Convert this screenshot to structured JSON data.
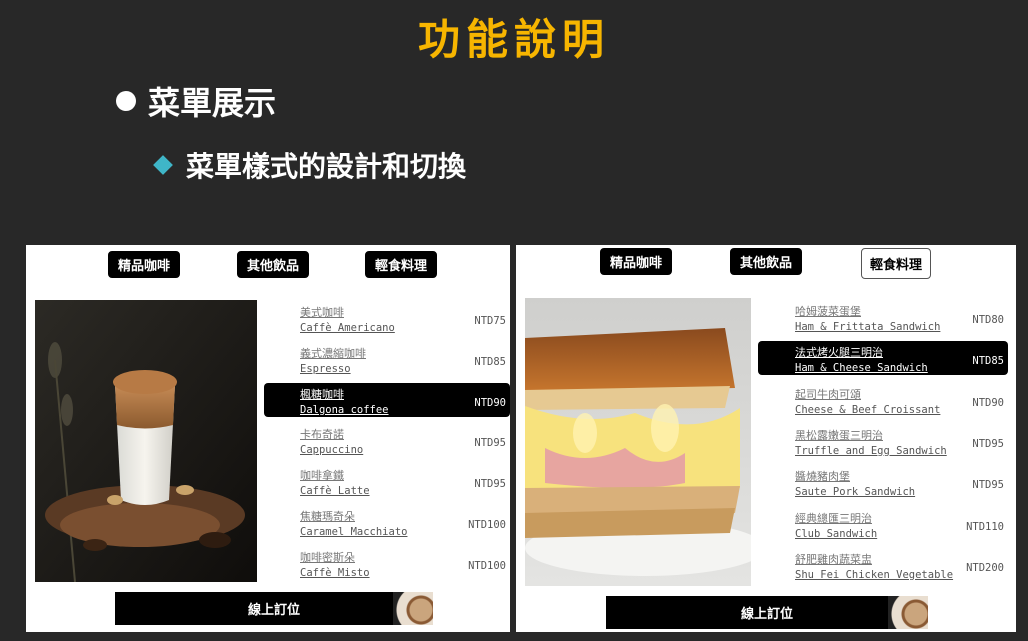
{
  "slide": {
    "title": "功能說明",
    "bullet1": "菜單展示",
    "bullet2": "菜單樣式的設計和切換"
  },
  "menu_left": {
    "tabs": [
      "精品咖啡",
      "其他飲品",
      "輕食料理"
    ],
    "items": [
      {
        "zh": "美式咖啡",
        "en": "Caffè Americano",
        "price": "NTD75"
      },
      {
        "zh": "義式濃縮咖啡",
        "en": "Espresso",
        "price": "NTD85"
      },
      {
        "zh": "楓糖咖啡",
        "en": "Dalgona coffee",
        "price": "NTD90",
        "active": true
      },
      {
        "zh": "卡布奇諾",
        "en": "Cappuccino",
        "price": "NTD95"
      },
      {
        "zh": "咖啡拿鐵",
        "en": "Caffè Latte",
        "price": "NTD95"
      },
      {
        "zh": "焦糖瑪奇朵",
        "en": "Caramel Macchiato",
        "price": "NTD100"
      },
      {
        "zh": "咖啡密斯朵",
        "en": "Caffè Misto",
        "price": "NTD100"
      }
    ],
    "order_label": "線上訂位",
    "photo_icon": "dalgona-coffee-photo"
  },
  "menu_right": {
    "tabs": [
      "精品咖啡",
      "其他飲品",
      "輕食料理"
    ],
    "items": [
      {
        "zh": "哈姆菠菜蛋堡",
        "en": "Ham & Frittata Sandwich",
        "price": "NTD80"
      },
      {
        "zh": "法式烤火腿三明治",
        "en": "Ham & Cheese Sandwich",
        "price": "NTD85",
        "active": true
      },
      {
        "zh": "起司牛肉可頌",
        "en": "Cheese & Beef Croissant",
        "price": "NTD90"
      },
      {
        "zh": "黑松露嫩蛋三明治",
        "en": "Truffle and Egg Sandwich",
        "price": "NTD95"
      },
      {
        "zh": "醬燒豬肉堡",
        "en": "Saute Pork Sandwich",
        "price": "NTD95"
      },
      {
        "zh": "經典總匯三明治",
        "en": "Club Sandwich",
        "price": "NTD110"
      },
      {
        "zh": "舒肥雞肉蔬菜盅",
        "en": "Shu Fei Chicken Vegetable",
        "price": "NTD200"
      }
    ],
    "order_label": "線上訂位",
    "photo_icon": "croque-monsieur-photo"
  },
  "colors": {
    "background": "#282828",
    "title": "#f7b500",
    "diamond": "#3fb6c8"
  }
}
